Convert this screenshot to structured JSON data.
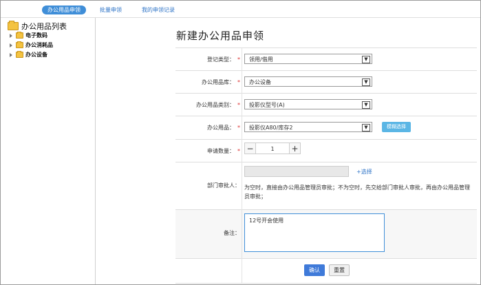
{
  "tabs": [
    {
      "label": "办公用品申领",
      "active": true
    },
    {
      "label": "批量申领",
      "active": false
    },
    {
      "label": "我的申领记录",
      "active": false
    }
  ],
  "sidebar": {
    "root": "办公用品列表",
    "items": [
      {
        "label": "电子数码"
      },
      {
        "label": "办公消耗品"
      },
      {
        "label": "办公设备"
      }
    ]
  },
  "page_title": "新建办公用品申领",
  "form": {
    "type": {
      "label": "登记类型：",
      "value": "领用/借用"
    },
    "library": {
      "label": "办公用品库：",
      "value": "办公设备"
    },
    "category": {
      "label": "办公用品类别：",
      "value": "投影仪型号(A)"
    },
    "item": {
      "label": "办公用品：",
      "value": "投影仪A80/库存2",
      "fuzzy_label": "模糊选择"
    },
    "quantity": {
      "label": "申请数量：",
      "value": "1",
      "minus": "−",
      "plus": "+"
    },
    "approver": {
      "label": "部门审批人：",
      "select_link": "+选择",
      "note": "为空时，直接由办公用品管理员审批；不为空时，先交给部门审批人审批，再由办公用品管理员审批；"
    },
    "remark": {
      "label": "备注：",
      "value": "12号开会使用"
    },
    "required_mark": "*"
  },
  "actions": {
    "confirm": "确认",
    "reset": "重置"
  },
  "colors": {
    "accent": "#3f8ed8",
    "required": "#dd3333",
    "fuzzy_button": "#5bb6e5"
  },
  "icons": [
    "folder-icon",
    "caret-right-icon",
    "dropdown-arrow-icon"
  ]
}
